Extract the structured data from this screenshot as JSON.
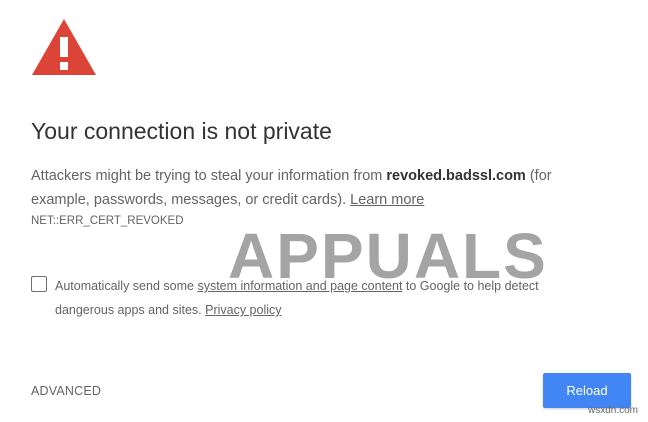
{
  "page": {
    "title": "Your connection is not private",
    "message_prefix": "Attackers might be trying to steal your information from ",
    "domain": "revoked.badssl.com",
    "message_suffix": " (for example, passwords, messages, or credit cards). ",
    "learn_more": "Learn more",
    "error_code": "NET::ERR_CERT_REVOKED"
  },
  "checkbox": {
    "checked": false,
    "text_prefix": "Automatically send some ",
    "link": "system information and page content",
    "text_middle": " to Google to help detect dangerous apps and sites. ",
    "privacy_link": "Privacy policy"
  },
  "actions": {
    "advanced_label": "ADVANCED",
    "reload_label": "Reload"
  },
  "watermark": {
    "logo_text": "APPUALS",
    "site_text": "wsxdn.com"
  },
  "colors": {
    "warning_red": "#db4437",
    "button_blue": "#4285f4",
    "text_gray": "#646464",
    "title_dark": "#333333"
  },
  "icons": {
    "warning": "warning-triangle-icon"
  }
}
